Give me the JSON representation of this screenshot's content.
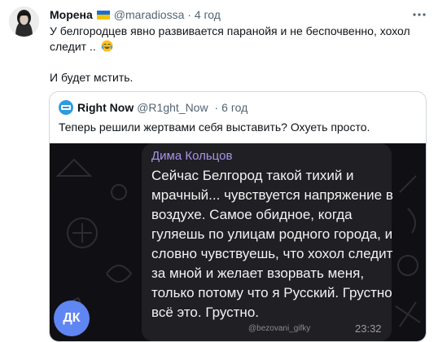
{
  "tweet": {
    "author_name": "Морена",
    "author_handle": "@maradiossa",
    "time": "4 год",
    "flag_icon": "ukraine-flag-icon",
    "text_line1": "У белгородцев явно развивается паранойя и не беспочвенно, хохол",
    "text_line2": "следит ..",
    "text_line3": "И будет мстить.",
    "emoji_icon": "crying-laughing-emoji-icon"
  },
  "quote": {
    "author_name": "Right Now",
    "author_handle": "@R1ght_Now",
    "time": "6 год",
    "text": "Теперь решили жертвами себя выставить? Охуеть просто.",
    "media": {
      "sender_name": "Дима Кольцов",
      "message_lines": [
        "Сейчас Белгород такой тихий и",
        "мрачный... чувствуется напряжение в",
        "воздухе. Самое обидное, когда",
        "гуляешь по улицам родного города, и",
        "словно чувствуешь, что хохол следит",
        "за мной и желает взорвать меня,",
        "только потому что я Русский. Грустно",
        "всё это. Грустно."
      ],
      "signature": "@bezovani_gifky",
      "time": "23:32",
      "avatar_initials": "ДК",
      "avatar_color": "#5f86f3",
      "sender_color": "#a994e8"
    }
  }
}
